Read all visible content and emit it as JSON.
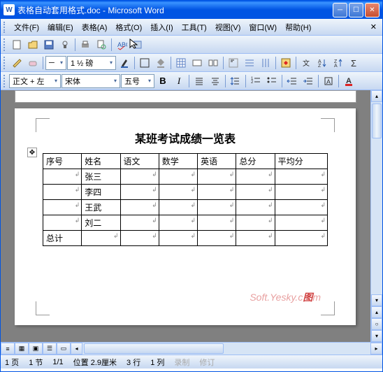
{
  "window": {
    "title": "表格自动套用格式.doc - Microsoft Word",
    "app_icon": "W"
  },
  "menu": {
    "items": [
      "文件(F)",
      "编辑(E)",
      "表格(A)",
      "格式(O)",
      "插入(I)",
      "工具(T)",
      "视图(V)",
      "窗口(W)",
      "帮助(H)"
    ]
  },
  "formatbar": {
    "style": "正文 + 左",
    "font": "宋体",
    "size": "五号",
    "bold": "B",
    "italic": "I"
  },
  "toolbar2": {
    "zoom_combo": "1 ½ 磅"
  },
  "document": {
    "title": "某班考试成绩一览表",
    "headers": [
      "序号",
      "姓名",
      "语文",
      "数学",
      "英语",
      "总分",
      "平均分"
    ],
    "rows": [
      [
        "",
        "张三",
        "",
        "",
        "",
        "",
        ""
      ],
      [
        "",
        "李四",
        "",
        "",
        "",
        "",
        ""
      ],
      [
        "",
        "王武",
        "",
        "",
        "",
        "",
        ""
      ],
      [
        "",
        "刘二",
        "",
        "",
        "",
        "",
        ""
      ],
      [
        "总计",
        "",
        "",
        "",
        "",
        "",
        ""
      ]
    ],
    "watermark_a": "Soft.Yesky.c",
    "watermark_b": "图",
    "watermark_c": "m"
  },
  "status": {
    "page": "1 页",
    "section": "1 节",
    "pages": "1/1",
    "position": "位置 2.9厘米",
    "line": "3 行",
    "col": "1 列",
    "rec": "录制",
    "rev": "修订"
  }
}
